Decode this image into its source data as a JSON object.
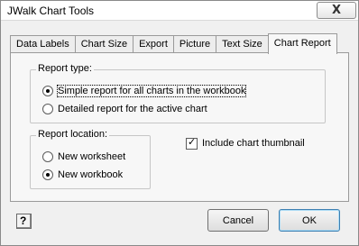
{
  "window": {
    "title": "JWalk Chart Tools",
    "close_glyph": "X"
  },
  "tabs": [
    {
      "label": "Data Labels",
      "active": false
    },
    {
      "label": "Chart Size",
      "active": false
    },
    {
      "label": "Export",
      "active": false
    },
    {
      "label": "Picture",
      "active": false
    },
    {
      "label": "Text Size",
      "active": false
    },
    {
      "label": "Chart Report",
      "active": true
    }
  ],
  "report_type": {
    "title": "Report type:",
    "options": [
      {
        "label": "Simple report for all charts in the workbook",
        "selected": true
      },
      {
        "label": "Detailed report for the active chart",
        "selected": false
      }
    ]
  },
  "report_location": {
    "title": "Report location:",
    "options": [
      {
        "label": "New worksheet",
        "selected": false
      },
      {
        "label": "New workbook",
        "selected": true
      }
    ]
  },
  "thumbnail": {
    "label": "Include chart thumbnail",
    "checked": true
  },
  "buttons": {
    "help": "?",
    "cancel": "Cancel",
    "ok": "OK"
  }
}
